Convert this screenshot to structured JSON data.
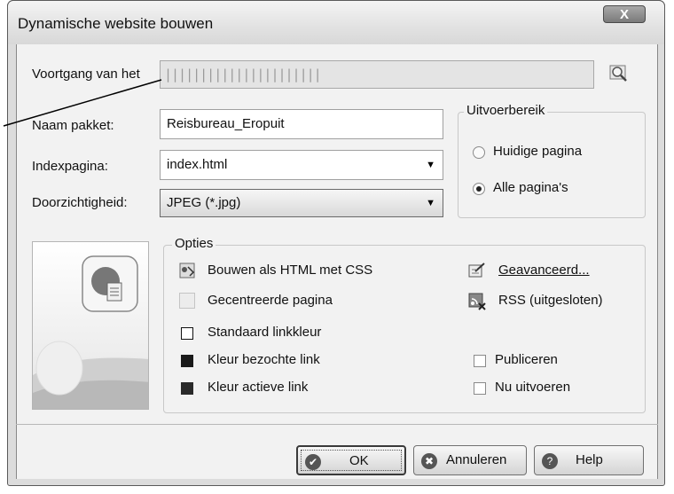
{
  "window": {
    "title": "Dynamische website bouwen",
    "close_label": "X"
  },
  "progress": {
    "label": "Voortgang van het",
    "ticks": "||||||||||||||||||||||"
  },
  "form": {
    "package_label": "Naam pakket:",
    "package_value": "Reisbureau_Eropuit",
    "index_label": "Indexpagina:",
    "index_value": "index.html",
    "transparency_label": "Doorzichtigheid:",
    "transparency_value": "JPEG (*.jpg)"
  },
  "output_range": {
    "title": "Uitvoerbereik",
    "options": [
      {
        "label": "Huidige pagina",
        "selected": false
      },
      {
        "label": "Alle pagina's",
        "selected": true
      }
    ]
  },
  "options": {
    "title": "Opties",
    "build_html_css": "Bouwen als HTML met CSS",
    "centered_page": "Gecentreerde pagina",
    "default_link_color": "Standaard linkkleur",
    "visited_link_color": "Kleur bezochte link",
    "active_link_color": "Kleur actieve link",
    "advanced": "Geavanceerd...",
    "rss": "RSS (uitgesloten)",
    "publish": "Publiceren",
    "run_now": "Nu uitvoeren"
  },
  "colors": {
    "default_link": "#ffffff",
    "visited_link": "#1a1a1a",
    "active_link": "#2a2a2a"
  },
  "buttons": {
    "ok": "OK",
    "cancel": "Annuleren",
    "help": "Help"
  }
}
